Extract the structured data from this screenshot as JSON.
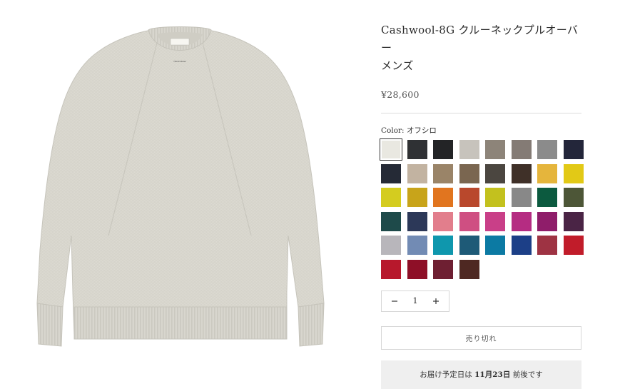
{
  "product": {
    "title_line1": "Cashwool-8G クルーネックプルオーバー",
    "title_line2": "メンズ",
    "price": "¥28,600",
    "label_text": "Hand-Ideas"
  },
  "color": {
    "label": "Color:",
    "selected_name": "オフシロ",
    "swatches": [
      "#e9e8e1",
      "#2f3134",
      "#232426",
      "#c7c3bc",
      "#8d8479",
      "#847b75",
      "#8b8b8b",
      "#23263a",
      "#252a36",
      "#c2b3a1",
      "#9a8468",
      "#7a6650",
      "#4b4640",
      "#3f3028",
      "#e5b53c",
      "#e2c916",
      "#d4cc1f",
      "#c8a41a",
      "#e1751f",
      "#b9482c",
      "#c3c11e",
      "#888888",
      "#0c5a3f",
      "#4d5637",
      "#1e4a4a",
      "#2c3858",
      "#e27e8c",
      "#cf4f82",
      "#c93f88",
      "#b52c82",
      "#8f1d6a",
      "#4a2445",
      "#b8b6bb",
      "#728bb4",
      "#0f97ad",
      "#1e5a77",
      "#0c7aa3",
      "#1c3f87",
      "#9e3343",
      "#c11c2a",
      "#b7182c",
      "#8e0f27",
      "#6e1f32",
      "#4e2822"
    ]
  },
  "quantity": {
    "minus": "−",
    "value": "1",
    "plus": "+"
  },
  "soldout_label": "売り切れ",
  "delivery": {
    "prefix": "お届け予定日は",
    "date": "11月23日",
    "suffix": "前後です"
  }
}
